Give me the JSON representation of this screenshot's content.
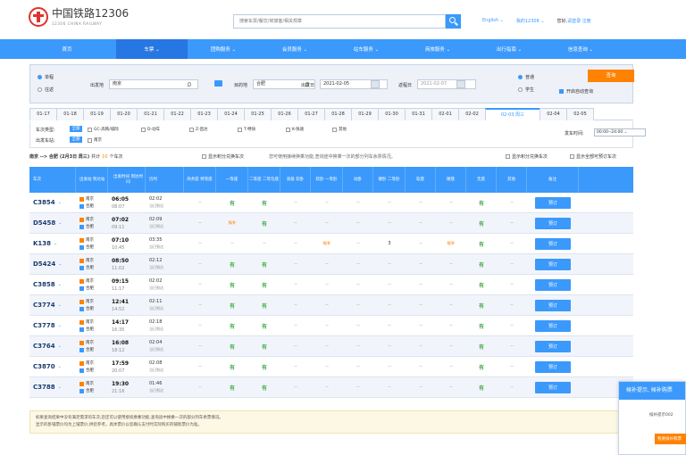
{
  "header": {
    "logo_title": "中国铁路12306",
    "logo_sub": "12306 CHINA RAILWAY",
    "search_placeholder": "搜索车票/餐饮/常旅客/相关规章",
    "lang": "English ⌄",
    "my": "我的12306 ⌄",
    "hello": "您好,",
    "login": "请登录",
    "register": "注册"
  },
  "nav": [
    {
      "label": "首页"
    },
    {
      "label": "车票 ⌄"
    },
    {
      "label": "团购服务 ⌄"
    },
    {
      "label": "会员服务 ⌄"
    },
    {
      "label": "站车服务 ⌄"
    },
    {
      "label": "商旅服务 ⌄"
    },
    {
      "label": "出行指南 ⌄"
    },
    {
      "label": "信息查询 ⌄"
    }
  ],
  "query": {
    "oneway": "单程",
    "roundtrip": "往返",
    "from_label": "出发地",
    "from_value": "南京",
    "to_label": "目的地",
    "to_value": "合肥",
    "date_label": "出发日",
    "date_value": "2021-02-05",
    "return_label": "返程日",
    "return_value": "2021-02-07",
    "normal": "普通",
    "student": "学生",
    "query_btn": "查询",
    "auto_label": "开启自动查询"
  },
  "dates": [
    "01-17",
    "01-18",
    "01-19",
    "01-20",
    "01-21",
    "01-22",
    "01-23",
    "01-24",
    "01-25",
    "01-26",
    "01-27",
    "01-28",
    "01-29",
    "01-30",
    "01-31",
    "02-01",
    "02-02",
    "02-03 周三",
    "02-04",
    "02-05"
  ],
  "filter": {
    "type_label": "车次类型:",
    "all": "全部",
    "types": [
      "GC-高铁/城际",
      "D-动车",
      "Z-直达",
      "T-特快",
      "K-快速",
      "其他"
    ],
    "station_label": "出发车站:",
    "stations": [
      "南京"
    ],
    "time_label": "发车时间:",
    "time_value": "00:00--24:00 ⌄"
  },
  "summary": {
    "route": "南京 --> 合肥",
    "date": "(2月3日 周三)",
    "count_prefix": "共计",
    "count": "10",
    "count_suffix": "个车次",
    "transfer": "显示积分兑换车次",
    "tip": "您可使用接续换乘功能,查询途中换乘一次的部分列车余票情况。",
    "opt1": "显示积分兑换车次",
    "opt2": "显示全部可预订车次"
  },
  "table": {
    "headers": [
      "车次",
      "出发站 到达站",
      "出发时间 到达时间",
      "历时",
      "商务座 特等座",
      "一等座",
      "二等座 二等包座",
      "高级 软卧",
      "软卧 一等卧",
      "动卧",
      "硬卧 二等卧",
      "软座",
      "硬座",
      "无座",
      "其他",
      "备注"
    ],
    "book_label": "预订",
    "rows": [
      {
        "train": "C3854",
        "from": "南京",
        "to": "合肥",
        "dep": "06:05",
        "arr": "08:07",
        "dur": "02:02",
        "sub": "当日到达",
        "seats": [
          "--",
          "有",
          "有",
          "--",
          "--",
          "--",
          "--",
          "--",
          "--",
          "有",
          "--"
        ]
      },
      {
        "train": "D5458",
        "from": "南京",
        "to": "合肥",
        "dep": "07:02",
        "arr": "09:11",
        "dur": "02:09",
        "sub": "当日到达",
        "seats": [
          "--",
          "候补",
          "有",
          "--",
          "--",
          "--",
          "--",
          "--",
          "--",
          "有",
          "--"
        ]
      },
      {
        "train": "K138",
        "from": "南京",
        "to": "合肥",
        "dep": "07:10",
        "arr": "10:45",
        "dur": "03:35",
        "sub": "当日到达",
        "seats": [
          "--",
          "--",
          "--",
          "--",
          "候补",
          "--",
          "3",
          "--",
          "候补",
          "有",
          "--"
        ]
      },
      {
        "train": "D5424",
        "from": "南京",
        "to": "合肥",
        "dep": "08:50",
        "arr": "11:02",
        "dur": "02:12",
        "sub": "当日到达",
        "seats": [
          "--",
          "有",
          "有",
          "--",
          "--",
          "--",
          "--",
          "--",
          "--",
          "有",
          "--"
        ]
      },
      {
        "train": "C3858",
        "from": "南京",
        "to": "合肥",
        "dep": "09:15",
        "arr": "11:17",
        "dur": "02:02",
        "sub": "当日到达",
        "seats": [
          "--",
          "有",
          "有",
          "--",
          "--",
          "--",
          "--",
          "--",
          "--",
          "有",
          "--"
        ]
      },
      {
        "train": "C3774",
        "from": "南京",
        "to": "合肥",
        "dep": "12:41",
        "arr": "14:52",
        "dur": "02:11",
        "sub": "当日到达",
        "seats": [
          "--",
          "有",
          "有",
          "--",
          "--",
          "--",
          "--",
          "--",
          "--",
          "有",
          "--"
        ]
      },
      {
        "train": "C3778",
        "from": "南京",
        "to": "合肥",
        "dep": "14:17",
        "arr": "16:35",
        "dur": "02:18",
        "sub": "当日到达",
        "seats": [
          "--",
          "有",
          "有",
          "--",
          "--",
          "--",
          "--",
          "--",
          "--",
          "有",
          "--"
        ]
      },
      {
        "train": "C3764",
        "from": "南京",
        "to": "合肥",
        "dep": "16:08",
        "arr": "18:12",
        "dur": "02:04",
        "sub": "当日到达",
        "seats": [
          "--",
          "有",
          "有",
          "--",
          "--",
          "--",
          "--",
          "--",
          "--",
          "有",
          "--"
        ]
      },
      {
        "train": "C3870",
        "from": "南京",
        "to": "合肥",
        "dep": "17:59",
        "arr": "20:07",
        "dur": "02:08",
        "sub": "当日到达",
        "seats": [
          "--",
          "有",
          "有",
          "--",
          "--",
          "--",
          "--",
          "--",
          "--",
          "有",
          "--"
        ]
      },
      {
        "train": "C3788",
        "from": "南京",
        "to": "合肥",
        "dep": "19:30",
        "arr": "21:16",
        "dur": "01:46",
        "sub": "当日到达",
        "seats": [
          "--",
          "有",
          "有",
          "--",
          "--",
          "--",
          "--",
          "--",
          "--",
          "有",
          "--"
        ]
      }
    ]
  },
  "notice": {
    "line1": "如果查询结果中没有满足需求的车次,您还可以使用接续换乘功能,查询途中换乘一次的部分列车余票情况。",
    "line2": "显示的卧铺票价均为上铺票价,供您参考。具体票价以您确认支付时实际购买的铺别票价为准。"
  },
  "float": {
    "title": "候补提示, 候补购票",
    "body": "候补提示002",
    "btn": "我要候补购票"
  },
  "colors": {
    "primary": "#3b99fc",
    "accent": "#ff8200",
    "available": "#4caf50"
  }
}
